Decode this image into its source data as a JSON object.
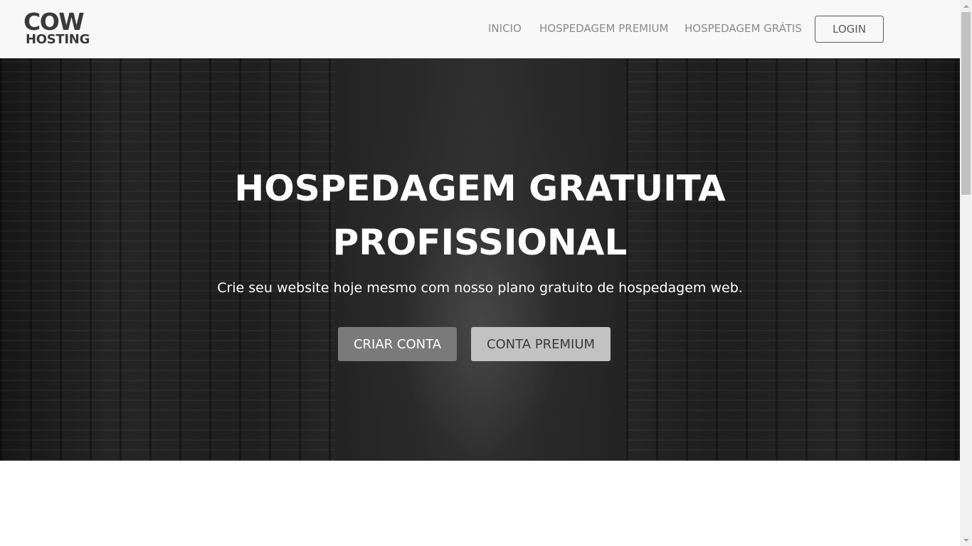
{
  "header": {
    "logo": {
      "line1": "COW",
      "line2": "HOSTING"
    },
    "nav": {
      "inicio": "INICIO",
      "premium": "HOSPEDAGEM PREMIUM",
      "gratis": "HOSPEDAGEM GRÁTIS",
      "login": "LOGIN"
    }
  },
  "hero": {
    "title_line1": "HOSPEDAGEM GRATUITA",
    "title_line2": "PROFISSIONAL",
    "subtitle": "Crie seu website hoje mesmo com nosso plano gratuito de hospedagem web.",
    "primary_button": "CRIAR CONTA",
    "secondary_button": "CONTA PREMIUM"
  },
  "colors": {
    "header_bg": "#f8f8f8",
    "primary_button_bg": "#7a7a7a",
    "secondary_button_bg": "#c2c2c2",
    "hero_text": "#ffffff"
  }
}
